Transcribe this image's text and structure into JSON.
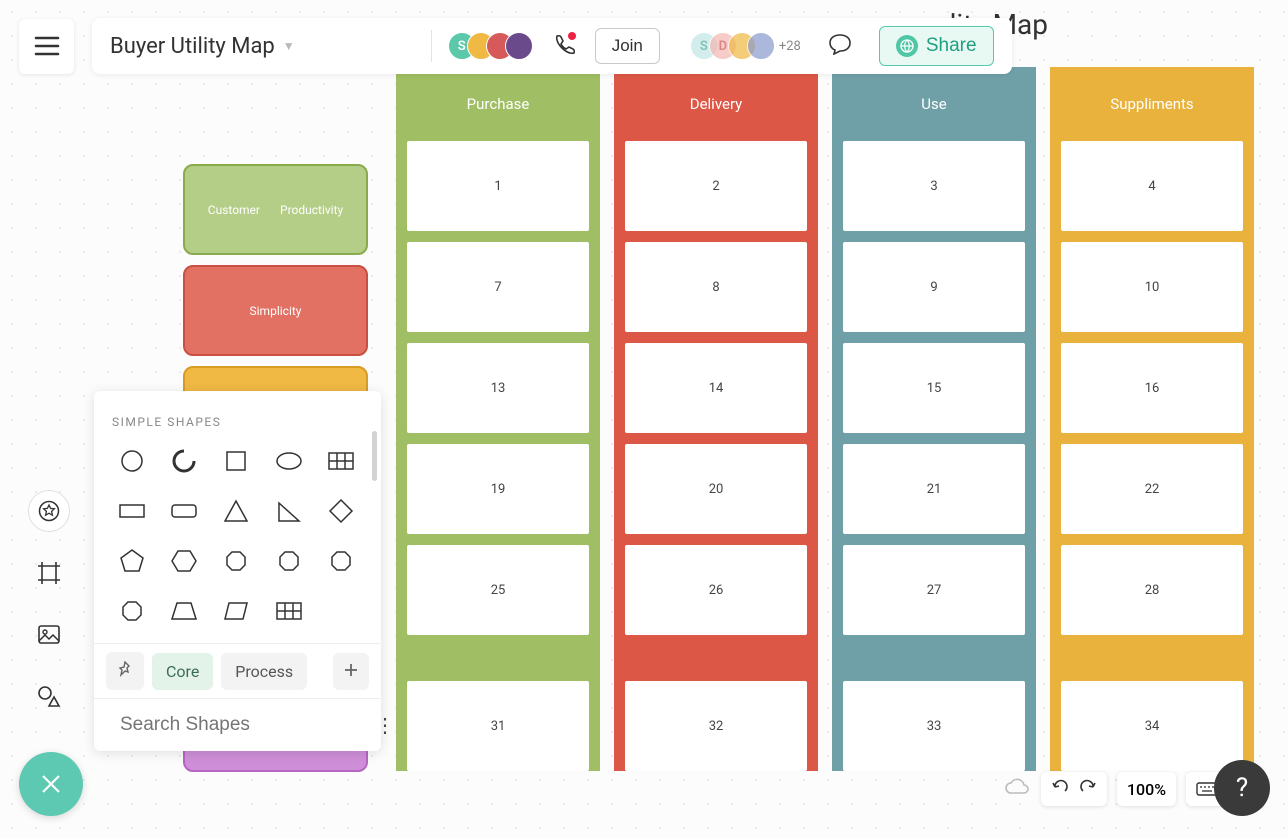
{
  "bg_title": "lity    Map",
  "doc_title": "Buyer Utility Map",
  "topbar": {
    "join_label": "Join",
    "share_label": "Share",
    "plus_count": "+28",
    "avatar_left": [
      {
        "label": "S",
        "bg": "#5bc9a9"
      },
      {
        "label": "",
        "bg": "#f0b944"
      },
      {
        "label": "",
        "bg": "#d75a5a"
      },
      {
        "label": "",
        "bg": "#b57fe0"
      }
    ],
    "avatar_right": [
      {
        "label": "S",
        "bg": "#bfe6e3"
      },
      {
        "label": "D",
        "bg": "#f4b6b0"
      },
      {
        "label": "",
        "bg": "#f0b944"
      },
      {
        "label": "",
        "bg": "#89c"
      }
    ]
  },
  "rows": {
    "r1a": "Customer",
    "r1b": "Productivity",
    "r2": "Simplicity"
  },
  "columns": [
    {
      "key": "purchase",
      "label": "Purchase",
      "cells": [
        "1",
        "7",
        "13",
        "19",
        "25",
        "31"
      ]
    },
    {
      "key": "delivery",
      "label": "Delivery",
      "cells": [
        "2",
        "8",
        "14",
        "20",
        "26",
        "32"
      ]
    },
    {
      "key": "use",
      "label": "Use",
      "cells": [
        "3",
        "9",
        "15",
        "21",
        "27",
        "33"
      ]
    },
    {
      "key": "suppliments",
      "label": "Suppliments",
      "cells": [
        "4",
        "10",
        "16",
        "22",
        "28",
        "34"
      ]
    }
  ],
  "shapes_panel": {
    "header": "SIMPLE SHAPES",
    "tabs": {
      "core": "Core",
      "process": "Process"
    },
    "search_placeholder": "Search Shapes"
  },
  "bottom": {
    "zoom": "100%"
  }
}
